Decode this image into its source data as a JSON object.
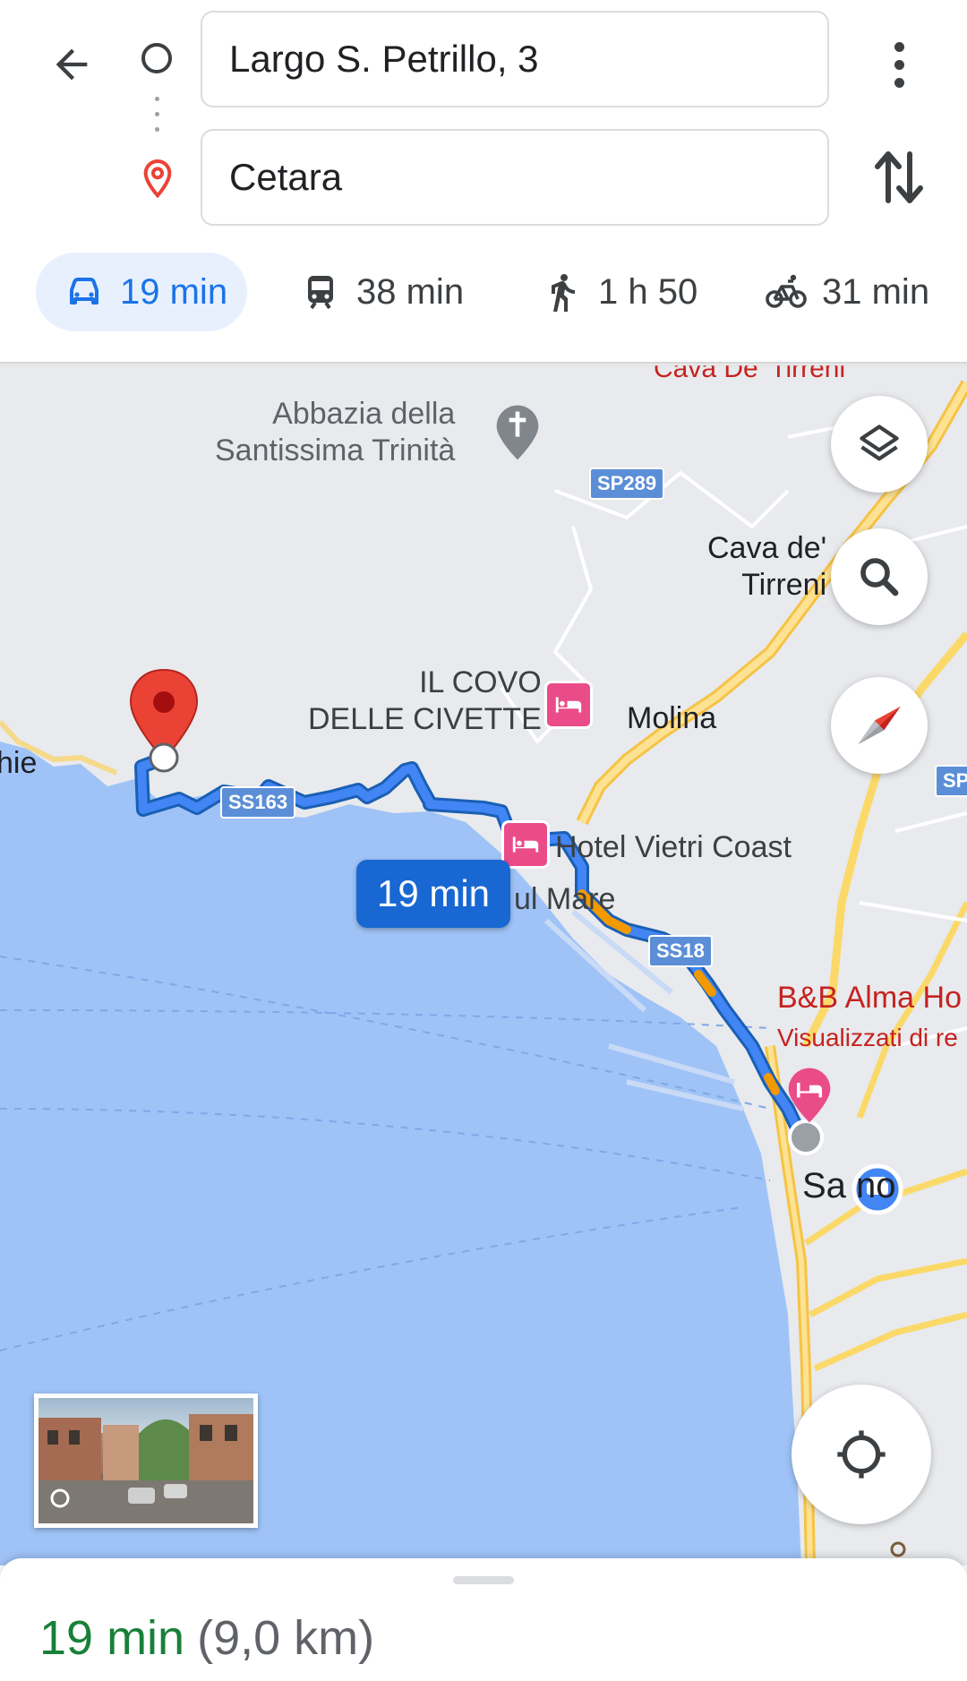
{
  "directions": {
    "origin_value": "Largo S. Petrillo, 3",
    "destination_value": "Cetara"
  },
  "travel_modes": [
    {
      "mode": "driving",
      "icon": "car-icon",
      "time": "19 min",
      "selected": true
    },
    {
      "mode": "transit",
      "icon": "train-icon",
      "time": "38 min"
    },
    {
      "mode": "walking",
      "icon": "walking-icon",
      "time": "1 h 50"
    },
    {
      "mode": "cycling",
      "icon": "bike-icon",
      "time": "31 min"
    }
  ],
  "map": {
    "labels": {
      "abbey_line1": "Abbazia della",
      "abbey_line2": "Santissima Trinità",
      "cava_top": "Cava De' Tirreni",
      "cava_line1": "Cava de'",
      "cava_line2": "Tirreni",
      "covo_line1": "IL COVO",
      "covo_line2": "DELLE CIVETTE",
      "molina": "Molina",
      "hotel_vietri": "Hotel Vietri Coast",
      "sul_mare": "ul Mare",
      "bb_alma": "B&B Alma Ho",
      "visualizzati": "Visualizzati di re",
      "salerno": "Sa  no",
      "hie": "hie"
    },
    "road_shields": {
      "sp289": "SP289",
      "ss163": "SS163",
      "ss18": "SS18",
      "sp_edge": "SP"
    },
    "route_time_callout": "19 min",
    "colors": {
      "route": "#4285f4",
      "route_border": "#1a5fb4",
      "traffic": "#f29900",
      "sea": "#9fc3f7",
      "land": "#e8eaed",
      "highway": "#fbd969",
      "destination_pin": "#ea4335"
    }
  },
  "summary": {
    "duration": "19 min",
    "distance": "(9,0 km)"
  }
}
